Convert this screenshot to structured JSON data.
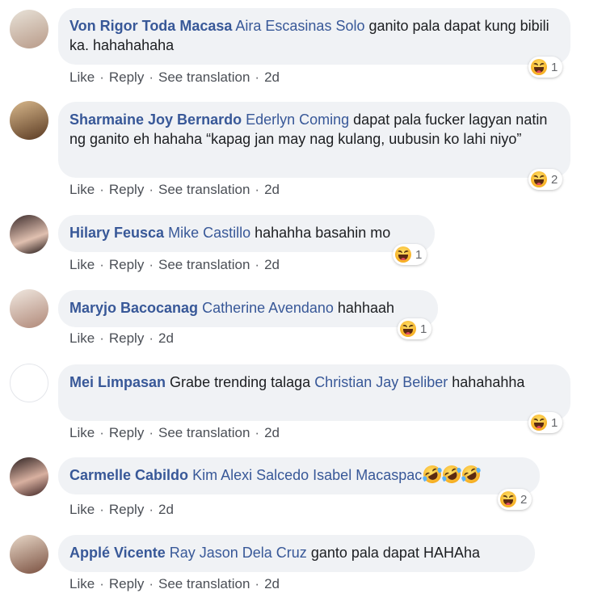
{
  "comments": [
    {
      "author": "Von Rigor Toda Macasa",
      "mentions": [
        "Aira Escasinas Solo"
      ],
      "text": "ganito pala dapat kung bibili ka. hahahahaha",
      "reaction_count": "1",
      "actions": {
        "like": "Like",
        "reply": "Reply",
        "translate": "See translation",
        "time": "2d"
      }
    },
    {
      "author": "Sharmaine Joy Bernardo",
      "mentions": [
        "Ederlyn Coming"
      ],
      "text": "dapat pala fucker lagyan natin ng ganito eh hahaha “kapag jan may nag kulang, uubusin ko lahi niyo”",
      "reaction_count": "2",
      "actions": {
        "like": "Like",
        "reply": "Reply",
        "translate": "See translation",
        "time": "2d"
      }
    },
    {
      "author": "Hilary Feusca",
      "mentions": [
        "Mike Castillo"
      ],
      "text": "hahahha basahin mo",
      "reaction_count": "1",
      "actions": {
        "like": "Like",
        "reply": "Reply",
        "translate": "See translation",
        "time": "2d"
      }
    },
    {
      "author": "Maryjo Bacocanag",
      "mentions": [
        "Catherine Avendano"
      ],
      "text": "hahhaah",
      "reaction_count": "1",
      "actions": {
        "like": "Like",
        "reply": "Reply",
        "time": "2d"
      }
    },
    {
      "author": "Mei Limpasan",
      "text_before": "Grabe trending talaga",
      "mentions": [
        "Christian Jay Beliber"
      ],
      "text": "hahahahha",
      "reaction_count": "1",
      "actions": {
        "like": "Like",
        "reply": "Reply",
        "translate": "See translation",
        "time": "2d"
      }
    },
    {
      "author": "Carmelle Cabildo",
      "mentions": [
        "Kim Alexi Salcedo",
        "Isabel Macaspac"
      ],
      "text": "",
      "emoji": "rolling-on-floor-laughing x3",
      "reaction_count": "2",
      "actions": {
        "like": "Like",
        "reply": "Reply",
        "time": "2d"
      }
    },
    {
      "author": "Applé Vicente",
      "mentions": [
        "Ray Jason Dela Cruz"
      ],
      "text": "ganto pala dapat HAHAha",
      "actions": {
        "like": "Like",
        "reply": "Reply",
        "translate": "See translation",
        "time": "2d"
      }
    }
  ],
  "separator": "·",
  "colors": {
    "link": "#385898",
    "bubble": "#f0f2f5",
    "meta": "#65676b"
  },
  "reaction_icon": "haha-reaction-icon"
}
